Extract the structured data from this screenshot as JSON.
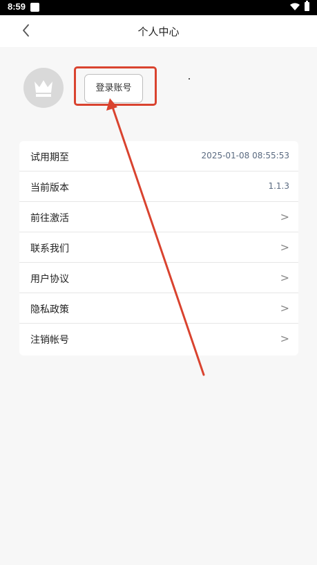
{
  "status_bar": {
    "time": "8:59"
  },
  "header": {
    "title": "个人中心"
  },
  "profile": {
    "login_label": "登录账号"
  },
  "menu": {
    "items": [
      {
        "label": "试用期至",
        "value": "2025-01-08 08:55:53",
        "chevron": ""
      },
      {
        "label": "当前版本",
        "value": "1.1.3",
        "chevron": ""
      },
      {
        "label": "前往激活",
        "value": "",
        "chevron": ">"
      },
      {
        "label": "联系我们",
        "value": "",
        "chevron": ">"
      },
      {
        "label": "用户协议",
        "value": "",
        "chevron": ">"
      },
      {
        "label": "隐私政策",
        "value": "",
        "chevron": ">"
      },
      {
        "label": "注销帐号",
        "value": "",
        "chevron": ">"
      }
    ]
  },
  "colors": {
    "annotation": "#d9432f",
    "value_text": "#5a6a80",
    "background": "#f7f7f7"
  },
  "icons": {
    "back": "chevron-left-icon",
    "avatar": "crown-icon",
    "wifi": "wifi-icon",
    "battery": "battery-icon"
  }
}
